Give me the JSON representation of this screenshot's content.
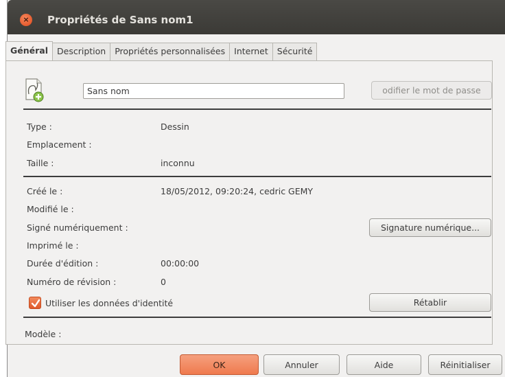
{
  "window": {
    "title": "Propriétés de Sans nom1",
    "close_symbol": "×"
  },
  "tabs": [
    {
      "label": "Général",
      "active": true
    },
    {
      "label": "Description"
    },
    {
      "label": "Propriétés personnalisées"
    },
    {
      "label": "Internet"
    },
    {
      "label": "Sécurité"
    }
  ],
  "general": {
    "document_icon": "drawing-document-icon",
    "name_value": "Sans nom",
    "change_password_label": "odifier le mot de passe",
    "type_label": "Type :",
    "type_value": "Dessin",
    "location_label": "Emplacement :",
    "location_value": "",
    "size_label": "Taille :",
    "size_value": "inconnu",
    "created_label": "Créé le :",
    "created_value": "18/05/2012, 09:20:24, cedric GEMY",
    "modified_label": "Modifié le :",
    "signed_label": "Signé numériquement :",
    "digital_signature_button": "Signature numérique...",
    "printed_label": "Imprimé le :",
    "editing_time_label": "Durée d'édition :",
    "editing_time_value": "00:00:00",
    "revision_label": "Numéro de révision :",
    "revision_value": "0",
    "use_identity_label": "Utiliser les données d'identité",
    "use_identity_checked": true,
    "reset_button": "Rétablir",
    "template_label": "Modèle :"
  },
  "footer": {
    "ok": "OK",
    "cancel": "Annuler",
    "help": "Aide",
    "reset": "Réinitialiser"
  },
  "colors": {
    "accent": "#ef7a4e",
    "titlebar": "#3c3b37"
  }
}
